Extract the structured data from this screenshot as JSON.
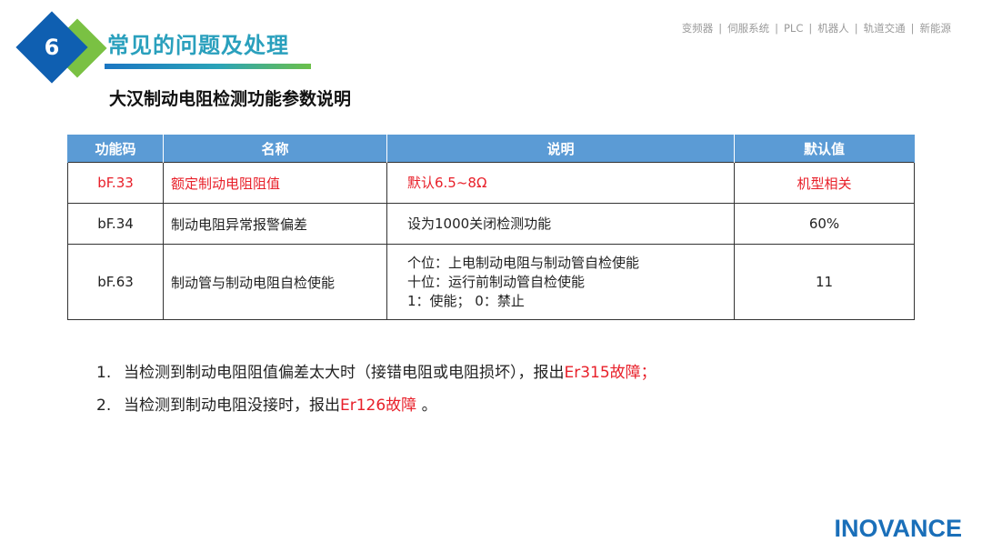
{
  "header": {
    "section_number": "6",
    "section_title": "常见的问题及处理",
    "nav": [
      "变频器",
      "伺服系统",
      "PLC",
      "机器人",
      "轨道交通",
      "新能源"
    ],
    "nav_separator": "|"
  },
  "subtitle": "大汉制动电阻检测功能参数说明",
  "table": {
    "headers": [
      "功能码",
      "名称",
      "说明",
      "默认值"
    ],
    "rows": [
      {
        "code": "bF.33",
        "name": "额定制动电阻阻值",
        "desc": [
          "默认6.5~8Ω"
        ],
        "default": "机型相关",
        "highlight": true
      },
      {
        "code": "bF.34",
        "name": "制动电阻异常报警偏差",
        "desc": [
          "设为1000关闭检测功能"
        ],
        "default": "60%",
        "highlight": false
      },
      {
        "code": "bF.63",
        "name": "制动管与制动电阻自检使能",
        "desc": [
          "个位：上电制动电阻与制动管自检使能",
          "十位：运行前制动管自检使能",
          "1：使能；  0：禁止"
        ],
        "default": "11",
        "highlight": false
      }
    ]
  },
  "notes": [
    {
      "num": "1.",
      "text": "当检测到制动电阻阻值偏差太大时（接错电阻或电阻损坏），报出",
      "highlight": "Er315故障；",
      "tail": ""
    },
    {
      "num": "2.",
      "text": "当检测到制动电阻没接时，报出",
      "highlight": "Er126故障",
      "tail": " 。"
    }
  ],
  "logo": "INOVANCE",
  "colors": {
    "accent_blue": "#0f5fb1",
    "accent_green": "#7ac143",
    "title_teal": "#2aa0bd",
    "table_header": "#5b9bd5",
    "highlight_red": "#e8202a",
    "logo_blue": "#1a6fb9"
  }
}
